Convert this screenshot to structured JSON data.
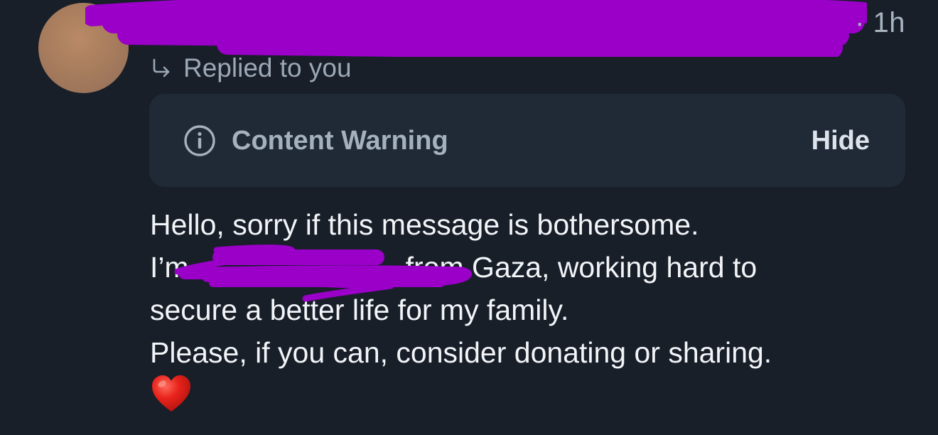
{
  "post": {
    "timestamp": "· 1h",
    "reply_context": "Replied to you",
    "content_warning": {
      "label": "Content Warning",
      "hide_label": "Hide"
    },
    "body_lines": [
      "Hello, sorry if this message is bothersome.",
      "I’m",
      "from Gaza, working hard to",
      "secure a better life for my family.",
      "Please, if you can, consider donating or sharing."
    ],
    "emoji": "heart-emoji"
  },
  "colors": {
    "background": "#181f29",
    "card": "#202a36",
    "muted_text": "#9ca8b6",
    "body_text": "#f2f4f7",
    "redaction": "#9a00c8",
    "heart": "#e0201a"
  }
}
